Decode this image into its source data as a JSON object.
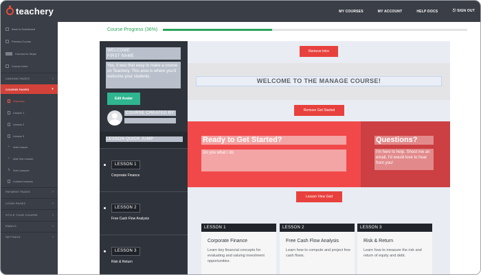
{
  "header": {
    "brand": "teachery",
    "nav": [
      "MY COURSES",
      "MY ACCOUNT",
      "HELP DOCS",
      "SIGN OUT"
    ]
  },
  "sidebar": {
    "top_items": [
      "Back to Dashboard",
      "Preview Course",
      "Connect to Stripe",
      "Course Links"
    ],
    "landing_pages": "LANDING PAGES",
    "course_pages": "COURSE PAGES",
    "sub_items": [
      "Overview",
      "Lesson 1",
      "Lesson 2",
      "Lesson 3",
      "Add Lesson",
      "Add Sub Lesson",
      "Sort Lessons",
      "Locked Lessons"
    ],
    "bottom_sections": [
      "PAYMENT PAGES",
      "LOGIN PAGES",
      "STYLE YOUR COURSE",
      "EMAILS",
      "SETTINGS"
    ]
  },
  "progress": {
    "label": "Course Progress",
    "percent_text": "(36%)",
    "value": 0.36
  },
  "left_panel": {
    "welcome": "WELCOME",
    "first_name": "FIRST NAME",
    "intro": "Yes, it was that easy to make a course on Teachery. This area is where you'd welcome your students.",
    "edit_avatar": "Edit Avatar",
    "created_by": "COURSE CREATED BY:",
    "quick_jump": "LESSON QUICK JUMP",
    "lessons": [
      {
        "label": "LESSON 1",
        "title": "Corporate Finance"
      },
      {
        "label": "LESSON 2",
        "title": "Free Cash Flow Analysis"
      },
      {
        "label": "LESSON 3",
        "title": "Risk & Return"
      }
    ]
  },
  "right_panel": {
    "remove_intro": "Remove Intro",
    "heading": "WELCOME TO THE MANAGE COURSE!",
    "remove_get_started": "Remove Get Started",
    "ready_title": "Ready to Get Started?",
    "ready_body": "Do you what I do",
    "questions_title": "Questions?",
    "questions_body": "I'm here to help. Shoot me an email, I'd would love to hear from you!",
    "lesson_view_grid": "Lesson View Grid",
    "cards": [
      {
        "label": "LESSON 1",
        "title": "Corporate Finance",
        "desc": "Learn key financial concepts for evaluating and valuing investment opportunities."
      },
      {
        "label": "LESSON 2",
        "title": "Free Cash Flow Analysis",
        "desc": "Learn how to compute and project free cash flows."
      },
      {
        "label": "LESSON 3",
        "title": "Risk & Return",
        "desc": "Learn how to measure the risk and return of equity and debt."
      }
    ]
  },
  "colors": {
    "topbar": "#3a3e46",
    "accent_red": "#e8413d",
    "progress_green": "#2aa45a",
    "teal_button": "#2fb58f"
  }
}
